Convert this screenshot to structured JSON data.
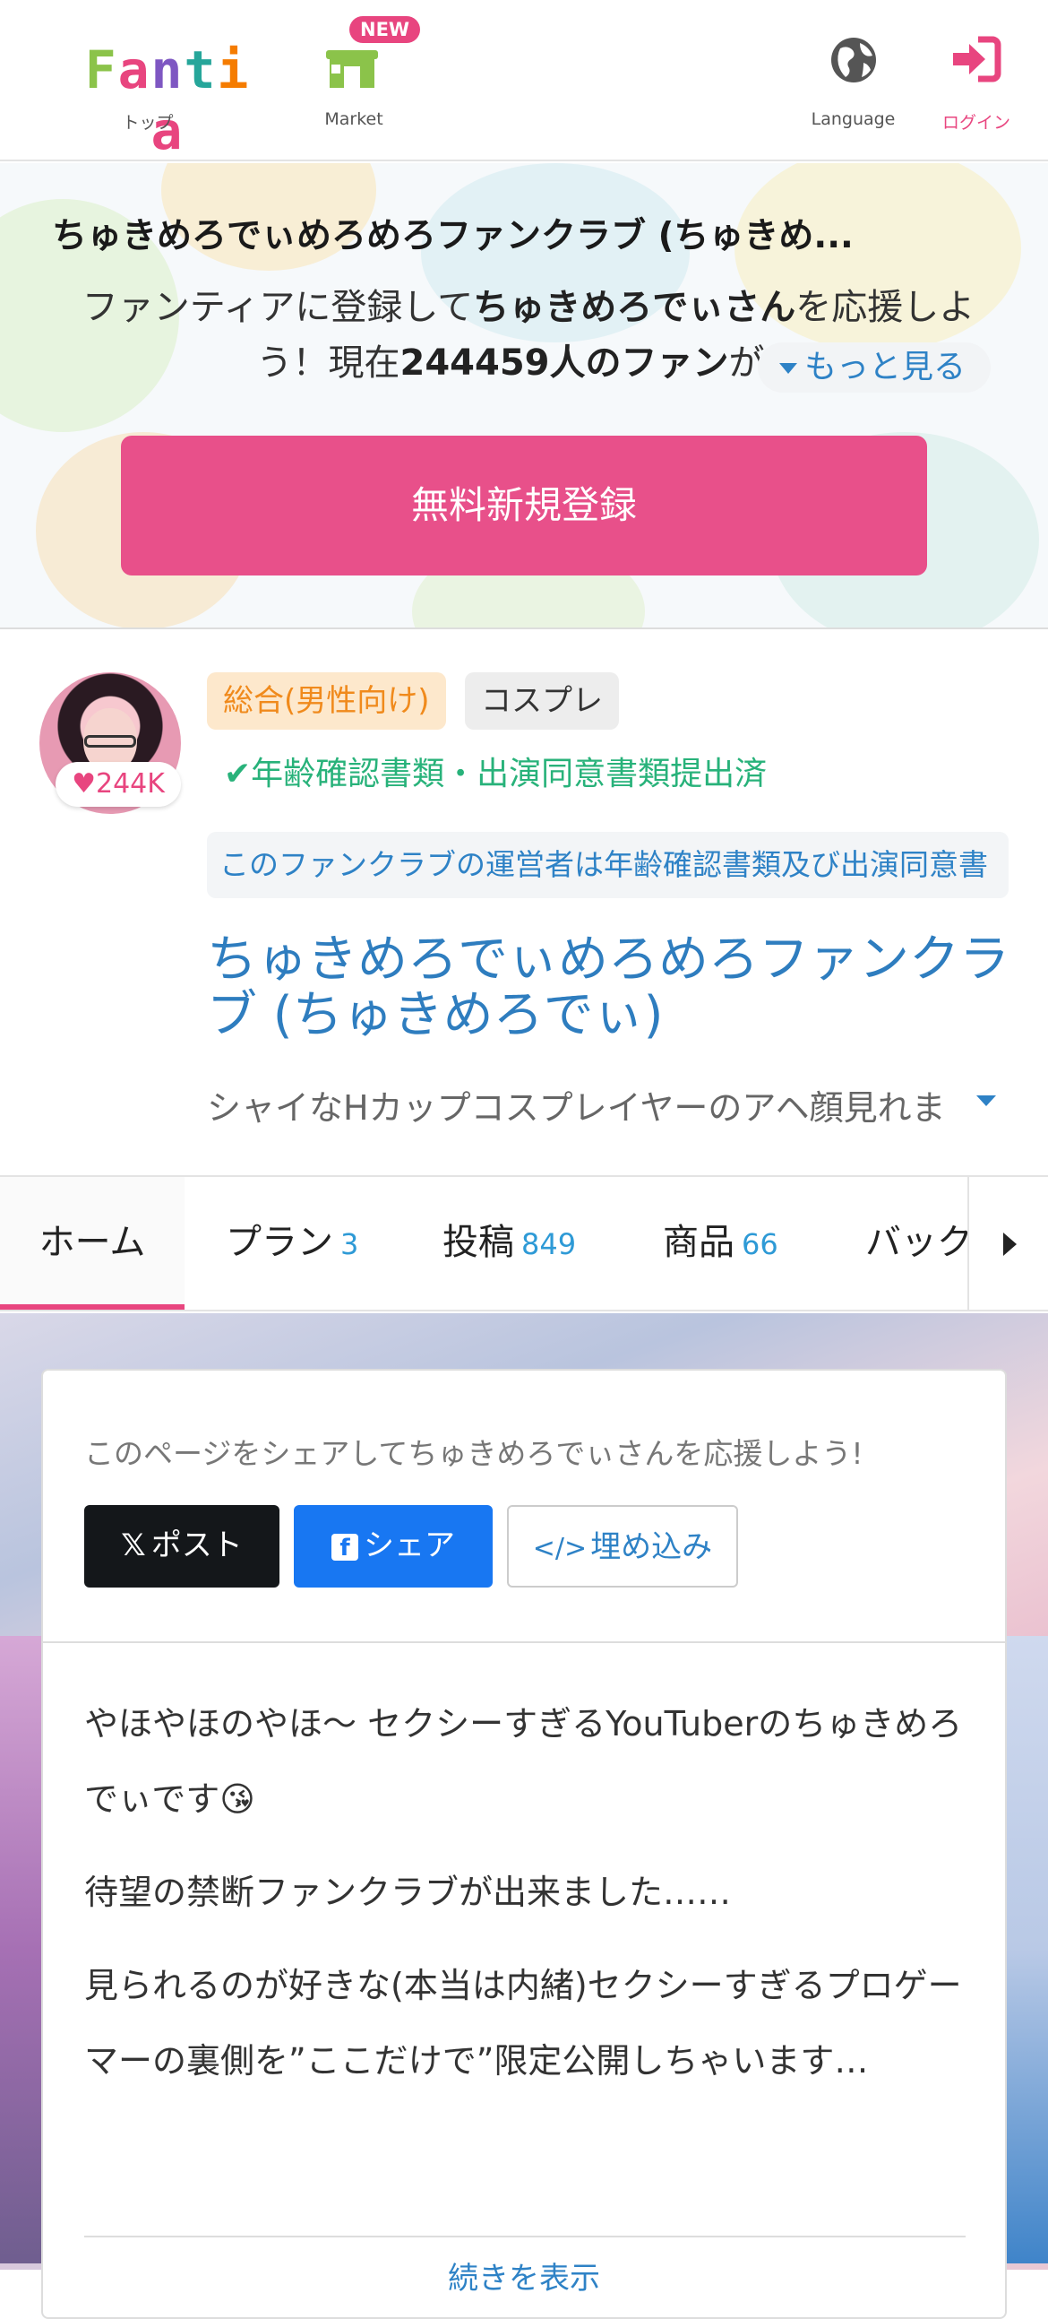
{
  "header": {
    "logo_text": "Fantia",
    "nav": [
      {
        "label": "トップ",
        "icon": "fantia-logo"
      },
      {
        "label": "Market",
        "icon": "market-shop-icon",
        "badge": "NEW"
      },
      {
        "label": "Language",
        "icon": "globe-icon"
      },
      {
        "label": "ログイン",
        "icon": "login-icon"
      }
    ]
  },
  "hero": {
    "title": "ちゅきめろでぃめろめろファンクラブ (ちゅきめ...",
    "desc_prefix": "ファンティアに登録して",
    "desc_name": "ちゅきめろでぃ",
    "desc_name_suffix": "さん",
    "desc_mid": "を応援しよう！現在",
    "desc_count": "244459人のファン",
    "desc_tail": "が応",
    "more_label": "もっと見る",
    "register_label": "無料新規登録"
  },
  "profile": {
    "fan_count": "244K",
    "tags": [
      "総合(男性向け)",
      "コスプレ"
    ],
    "verified": "年齢確認書類・出演同意書類提出済",
    "notice": "このファンクラブの運営者は年齢確認書類及び出演同意書",
    "fanclub_name": "ちゅきめろでぃめろめろファンクラブ (ちゅきめろでぃ)",
    "catchphrase": "シャイなHカップコスプレイヤーのアヘ顔見れま"
  },
  "tabs": [
    {
      "label": "ホーム",
      "count": ""
    },
    {
      "label": "プラン",
      "count": "3"
    },
    {
      "label": "投稿",
      "count": "849"
    },
    {
      "label": "商品",
      "count": "66"
    },
    {
      "label": "バック",
      "count": ""
    }
  ],
  "share": {
    "text": "このページをシェアしてちゅきめろでぃさんを応援しよう!",
    "x_label": "ポスト",
    "fb_label": "シェア",
    "embed_label": "埋め込み"
  },
  "intro": {
    "paragraphs": [
      "やほやほのやほ〜 セクシーすぎるYouTuberのちゅきめろでぃです😘",
      "待望の禁断ファンクラブが出来ました……",
      "見られるのが好きな(本当は内緒)セクシーすぎるプロゲーマーの裏側を”ここだけで”限定公開しちゃいます…"
    ],
    "read_more": "続きを表示"
  },
  "colors": {
    "brand_pink": "#e8457f",
    "link_blue": "#2e82c6",
    "verified_green": "#28b27a",
    "tag_orange": "#f08a1c"
  }
}
